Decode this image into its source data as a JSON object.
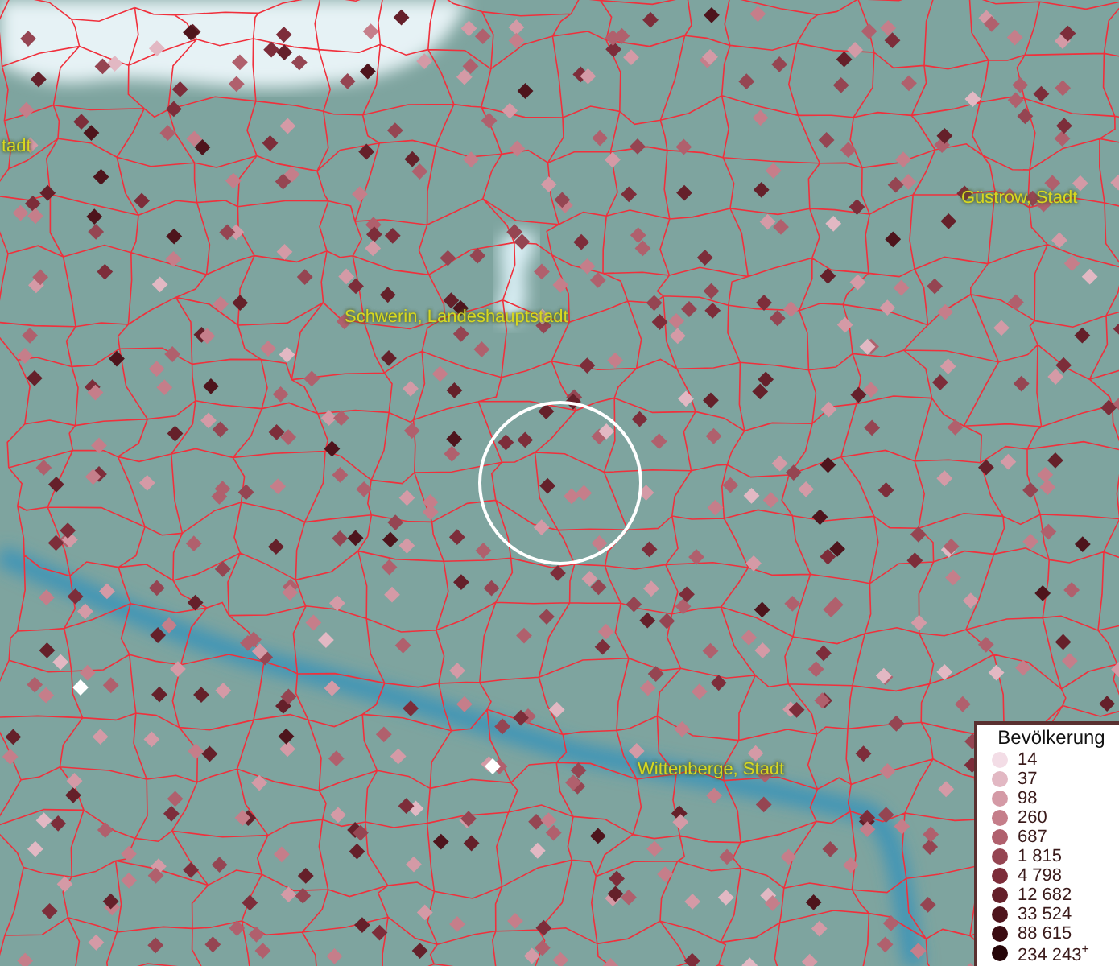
{
  "map": {
    "places": [
      {
        "label": "tadt",
        "kind": "city"
      },
      {
        "label": "Güstrow, Stadt",
        "kind": "city"
      },
      {
        "label": "Schwerin, Landeshauptstadt",
        "kind": "city"
      },
      {
        "label": "Wittenberge, Stadt",
        "kind": "city"
      }
    ]
  },
  "legend": {
    "title": "Bevölkerung",
    "items": [
      {
        "label": "14",
        "color": "#f3dde6"
      },
      {
        "label": "37",
        "color": "#e2b8c3"
      },
      {
        "label": "98",
        "color": "#d49aa6"
      },
      {
        "label": "260",
        "color": "#c57e8a"
      },
      {
        "label": "687",
        "color": "#b0606d"
      },
      {
        "label": "1 815",
        "color": "#954552"
      },
      {
        "label": "4 798",
        "color": "#7d2d3a"
      },
      {
        "label": "12 682",
        "color": "#65202a"
      },
      {
        "label": "33 524",
        "color": "#4e141c"
      },
      {
        "label": "88 615",
        "color": "#3a0b11"
      },
      {
        "label": "234 243$^{+}$",
        "color": "#260508"
      }
    ]
  }
}
